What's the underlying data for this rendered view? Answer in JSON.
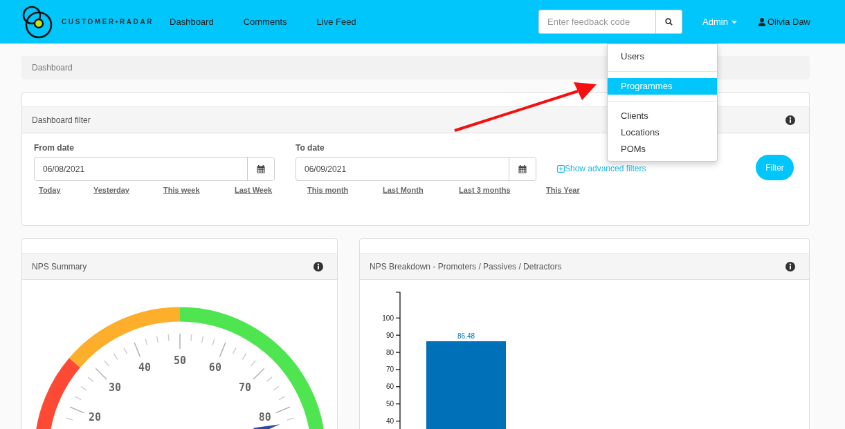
{
  "navbar": {
    "brand": "CUSTOMER•RADAR",
    "links": [
      {
        "label": "Dashboard"
      },
      {
        "label": "Comments"
      },
      {
        "label": "Live Feed"
      }
    ],
    "search": {
      "placeholder": "Enter feedback code"
    },
    "admin": {
      "label": "Admin"
    },
    "user": {
      "name": "Olivia Daw"
    }
  },
  "admin_menu": {
    "groups": [
      [
        {
          "label": "Users",
          "selected": false
        }
      ],
      [
        {
          "label": "Programmes",
          "selected": true
        }
      ],
      [
        {
          "label": "Clients",
          "selected": false
        },
        {
          "label": "Locations",
          "selected": false
        },
        {
          "label": "POMs",
          "selected": false
        }
      ]
    ]
  },
  "breadcrumb": [
    "Dashboard"
  ],
  "filter_panel": {
    "title": "Dashboard filter",
    "from": {
      "label": "From date",
      "value": "06/08/2021"
    },
    "to": {
      "label": "To date",
      "value": "06/09/2021"
    },
    "advanced_link": "Show advanced filters",
    "button": "Filter",
    "quick_ranges": [
      "Today",
      "Yesterday",
      "This week",
      "Last Week",
      "This month",
      "Last Month",
      "Last 3 months",
      "This Year"
    ]
  },
  "nps_summary": {
    "title": "NPS Summary",
    "gauge": {
      "level": 0.83,
      "labels": [
        "20",
        "30",
        "40",
        "50",
        "60",
        "70",
        "80"
      ]
    }
  },
  "nps_breakdown": {
    "title": "NPS Breakdown - Promoters / Passives / Detractors",
    "chart_data": {
      "type": "bar",
      "series": [
        {
          "color": "#0070b8",
          "values": [
            86.48
          ]
        }
      ],
      "ylim": [
        35,
        115
      ],
      "yticks": [
        40,
        50,
        60,
        70,
        80,
        90,
        100
      ],
      "data_labels": true
    }
  }
}
